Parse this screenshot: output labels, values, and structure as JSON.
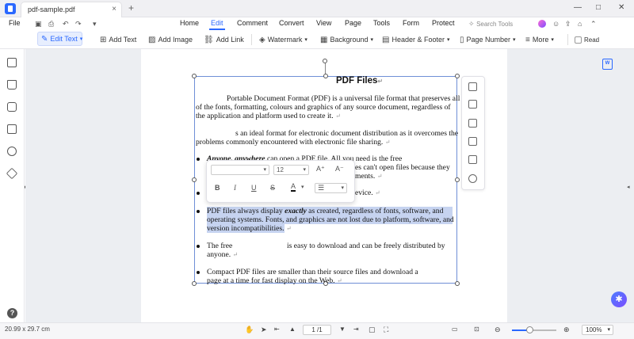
{
  "titlebar": {
    "tab_title": "pdf-sample.pdf",
    "tab_close": "×",
    "tab_add": "+",
    "win_controls": [
      "—",
      "□",
      "✕"
    ]
  },
  "menubar": {
    "file": "File",
    "items": [
      "Home",
      "Edit",
      "Comment",
      "Convert",
      "View",
      "Page",
      "Tools",
      "Form",
      "Protect"
    ],
    "active": "Edit",
    "search_placeholder": "Search Tools"
  },
  "toolbar": {
    "edit_text": "Edit Text",
    "add_text": "Add Text",
    "add_image": "Add Image",
    "add_link": "Add Link",
    "watermark": "Watermark",
    "background": "Background",
    "header_footer": "Header & Footer",
    "page_number": "Page Number",
    "more": "More",
    "read": "Read"
  },
  "document": {
    "title": "PDF Files",
    "lines": [
      "Portable Document Format (PDF) is a universal file format that preserves all",
      "of the fonts, formatting, colours and graphics of any source document, regardless of",
      "the application and platform used to create it.",
      "s an ideal format for electronic document distribution as it overcomes the",
      "problems commonly encountered with electronic file sharing.",
      "Anyone, anywhere",
      "can open a PDF file. All you need is the free",
      "es can't open files because they",
      "ments.",
      "evice.",
      "PDF files always display ",
      "exactly",
      " as created, regardless of fonts, software, and",
      "operating systems. Fonts, and graphics are not lost due to platform, software, and",
      "version incompatibilities.",
      "The free",
      "is easy to download and can be freely distributed by",
      "anyone.",
      "Compact PDF files are smaller than their source files and download a",
      "page at a time for fast display on the Web."
    ],
    "para_mark": "↵"
  },
  "format_panel": {
    "font_size": "12",
    "bold": "B",
    "italic": "I",
    "underline": "U",
    "strike": "S",
    "font_color": "A",
    "grow": "A⁺",
    "shrink": "A⁻"
  },
  "statusbar": {
    "dimensions": "20.99 x 29.7 cm",
    "page": "1 /1",
    "zoom": "100%",
    "zoom_fraction": 0.4
  },
  "colors": {
    "accent": "#2a68ff",
    "highlight": "#c6d3f0"
  }
}
